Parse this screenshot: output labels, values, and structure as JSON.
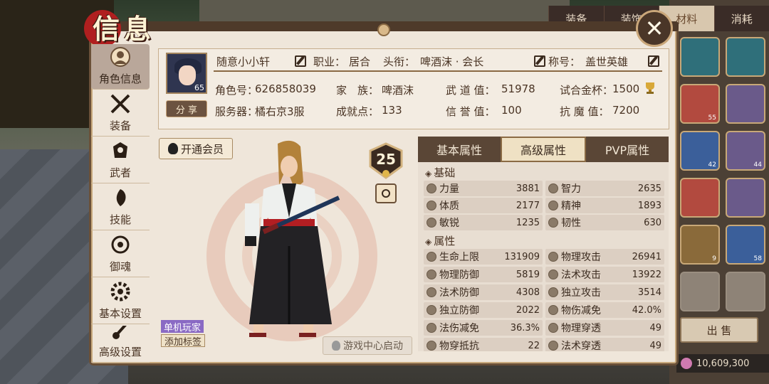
{
  "title": "信息",
  "inventory": {
    "tabs": [
      {
        "label": "装备",
        "active": false
      },
      {
        "label": "装饰",
        "active": false
      },
      {
        "label": "材料",
        "active": true
      },
      {
        "label": "消耗",
        "active": false
      }
    ],
    "slot_counts": [
      "",
      "",
      "55",
      "",
      "42",
      "44",
      "",
      "",
      "9",
      "58",
      "",
      ""
    ],
    "sell_label": "出 售",
    "money": "10,609,300"
  },
  "nav": [
    {
      "label": "角色信息",
      "icon": "character-icon",
      "active": true
    },
    {
      "label": "装备",
      "icon": "equipment-icon",
      "active": false
    },
    {
      "label": "武者",
      "icon": "warrior-icon",
      "active": false
    },
    {
      "label": "技能",
      "icon": "skill-icon",
      "active": false
    },
    {
      "label": "御魂",
      "icon": "soul-icon",
      "active": false
    },
    {
      "label": "基本设置",
      "icon": "settings-icon",
      "active": false
    },
    {
      "label": "高级设置",
      "icon": "advanced-settings-icon",
      "active": false
    }
  ],
  "header": {
    "name": "随意小小轩",
    "level": "65",
    "profession_label": "职业：",
    "profession": "居合",
    "rank_label": "头衔：",
    "rank": "啤酒沫 · 会长",
    "title_label": "称号：",
    "title_value": "盖世英雄",
    "share_label": "分 享",
    "role_id_label": "角色号：",
    "role_id": "626858039",
    "family_label": "家　族：",
    "family": "啤酒沫",
    "martial_label": "武 道 值：",
    "martial": "51978",
    "trial_label": "试合金杯：",
    "trial": "1500",
    "server_label": "服务器：",
    "server": "橘右京3服",
    "achievement_label": "成就点：",
    "achievement": "133",
    "honor_label": "信 誉 值：",
    "honor": "100",
    "antimagic_label": "抗 魔 值：",
    "antimagic": "7200"
  },
  "character": {
    "vip_label": "开通会员",
    "level_badge": "25",
    "tag1": "单机玩家",
    "tag2": "添加标签",
    "game_center_label": "游戏中心启动"
  },
  "attributes": {
    "tabs": [
      {
        "label": "基本属性",
        "active": false
      },
      {
        "label": "高级属性",
        "active": true
      },
      {
        "label": "PVP属性",
        "active": false
      }
    ],
    "section1": "基础",
    "basics": [
      [
        {
          "name": "力量",
          "value": "3881"
        },
        {
          "name": "智力",
          "value": "2635"
        }
      ],
      [
        {
          "name": "体质",
          "value": "2177"
        },
        {
          "name": "精神",
          "value": "1893"
        }
      ],
      [
        {
          "name": "敏锐",
          "value": "1235"
        },
        {
          "name": "韧性",
          "value": "630"
        }
      ]
    ],
    "section2": "属性",
    "props": [
      [
        {
          "name": "生命上限",
          "value": "131909"
        },
        {
          "name": "物理攻击",
          "value": "26941"
        }
      ],
      [
        {
          "name": "物理防御",
          "value": "5819"
        },
        {
          "name": "法术攻击",
          "value": "13922"
        }
      ],
      [
        {
          "name": "法术防御",
          "value": "4308"
        },
        {
          "name": "独立攻击",
          "value": "3514"
        }
      ],
      [
        {
          "name": "独立防御",
          "value": "2022"
        },
        {
          "name": "物伤减免",
          "value": "42.0%"
        }
      ],
      [
        {
          "name": "法伤减免",
          "value": "36.3%"
        },
        {
          "name": "物理穿透",
          "value": "49"
        }
      ],
      [
        {
          "name": "物穿抵抗",
          "value": "22"
        },
        {
          "name": "法术穿透",
          "value": "49"
        }
      ]
    ]
  }
}
